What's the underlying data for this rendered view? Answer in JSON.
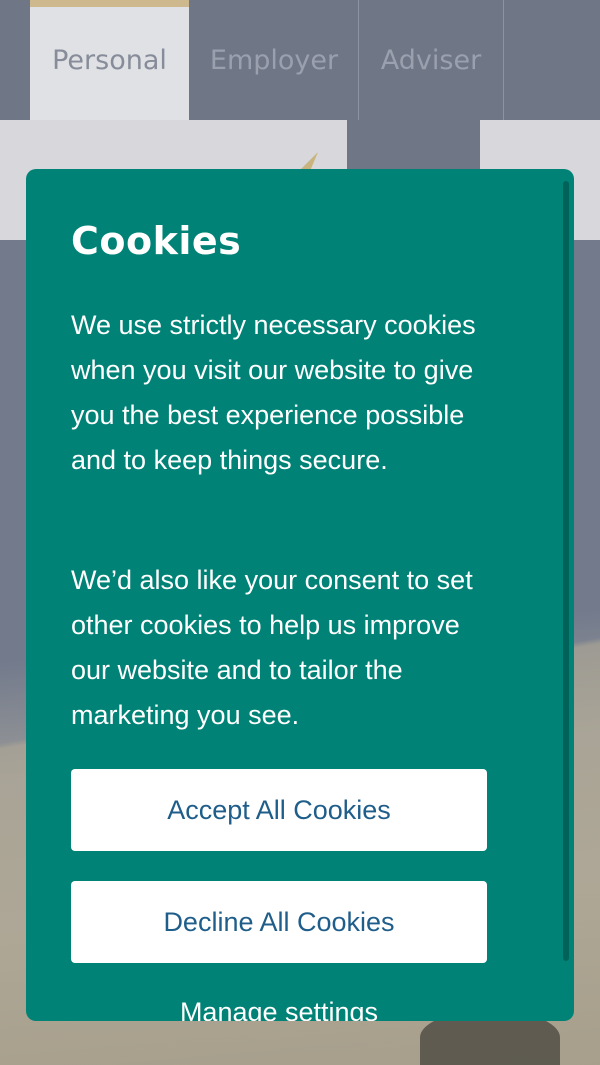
{
  "tabs": [
    {
      "label": "Personal",
      "active": true
    },
    {
      "label": "Employer",
      "active": false
    },
    {
      "label": "Adviser",
      "active": false
    }
  ],
  "cookie_modal": {
    "title": "Cookies",
    "paragraph_1": "We use strictly necessary cookies when you visit our website to give you the best experience possible and to keep things secure.",
    "paragraph_2": "We’d also like your consent to set other cookies to help us improve our website and to tailor the marketing you see.",
    "accept_label": "Accept All Cookies",
    "decline_label": "Decline All Cookies",
    "manage_label": "Manage settings"
  },
  "colors": {
    "modal_bg": "#008276",
    "button_text": "#1f5e8a",
    "active_tab_accent": "#cdb98d",
    "overlay_nav": "#6f7686"
  }
}
